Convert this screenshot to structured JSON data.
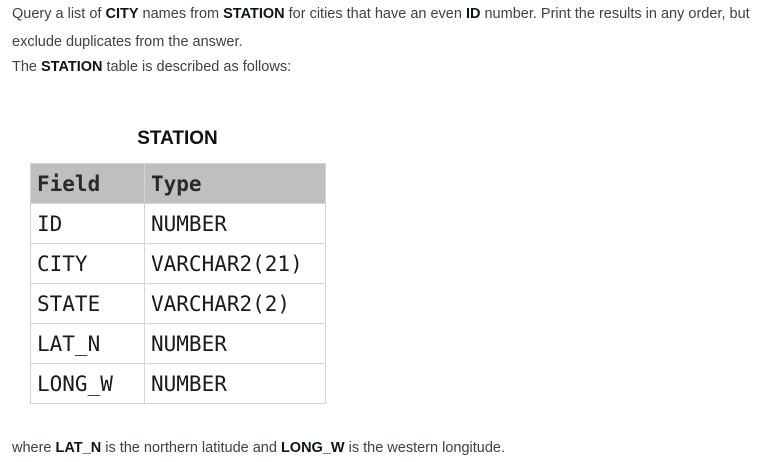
{
  "intro": {
    "p1": [
      "Query a list of ",
      "CITY",
      " names from ",
      "STATION",
      " for cities that have an even ",
      "ID",
      " number. Print the results in any order, but exclude duplicates from the answer."
    ],
    "p2": [
      "The ",
      "STATION",
      " table is described as follows:"
    ]
  },
  "table": {
    "title": "STATION",
    "headers": [
      "Field",
      "Type"
    ],
    "rows": [
      [
        "ID",
        "NUMBER"
      ],
      [
        "CITY",
        "VARCHAR2(21)"
      ],
      [
        "STATE",
        "VARCHAR2(2)"
      ],
      [
        "LAT_N",
        "NUMBER"
      ],
      [
        "LONG_W",
        "NUMBER"
      ]
    ]
  },
  "outro": {
    "p3": [
      "where ",
      "LAT_N",
      " is the northern latitude and ",
      "LONG_W",
      " is the western longitude."
    ]
  }
}
